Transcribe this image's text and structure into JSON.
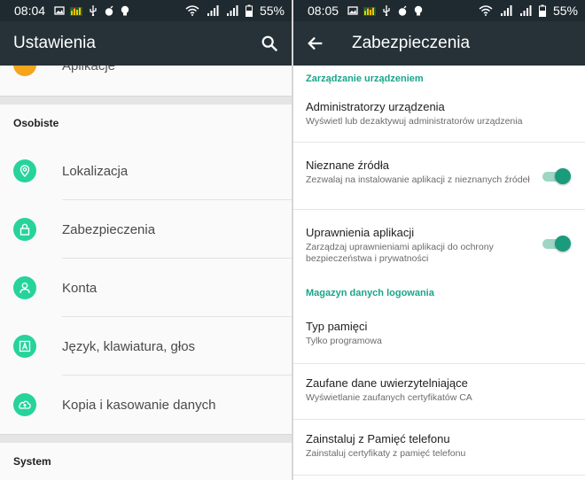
{
  "left": {
    "status": {
      "time": "08:04",
      "battery": "55%"
    },
    "title": "Ustawienia",
    "partial_item": "Aplikacje",
    "section1": "Osobiste",
    "items": [
      {
        "label": "Lokalizacja",
        "icon": "location-icon"
      },
      {
        "label": "Zabezpieczenia",
        "icon": "lock-icon"
      },
      {
        "label": "Konta",
        "icon": "account-icon"
      },
      {
        "label": "Język, klawiatura, głos",
        "icon": "language-icon"
      },
      {
        "label": "Kopia i kasowanie danych",
        "icon": "cloud-backup-icon"
      }
    ],
    "section2": "System"
  },
  "right": {
    "status": {
      "time": "08:05",
      "battery": "55%"
    },
    "title": "Zabezpieczenia",
    "cat1": "Zarządzanie urządzeniem",
    "items1": [
      {
        "title": "Administratorzy urządzenia",
        "subtitle": "Wyświetl lub dezaktywuj administratorów urządzenia"
      },
      {
        "title": "Nieznane źródła",
        "subtitle": "Zezwalaj na instalowanie aplikacji z nieznanych źródeł",
        "toggle": true
      },
      {
        "title": "Uprawnienia aplikacji",
        "subtitle": "Zarządzaj uprawnieniami aplikacji do ochrony bezpieczeństwa i prywatności",
        "toggle": true
      }
    ],
    "cat2": "Magazyn danych logowania",
    "items2": [
      {
        "title": "Typ pamięci",
        "subtitle": "Tylko programowa"
      },
      {
        "title": "Zaufane dane uwierzytelniające",
        "subtitle": "Wyświetlanie zaufanych certyfikatów CA"
      },
      {
        "title": "Zainstaluj z Pamięć telefonu",
        "subtitle": "Zainstaluj certyfikaty z pamięć telefonu"
      }
    ]
  },
  "colors": {
    "appbar": "#263238",
    "accent": "#26d39b",
    "category": "#1aa58a",
    "toggle": "#1a9b7c"
  }
}
